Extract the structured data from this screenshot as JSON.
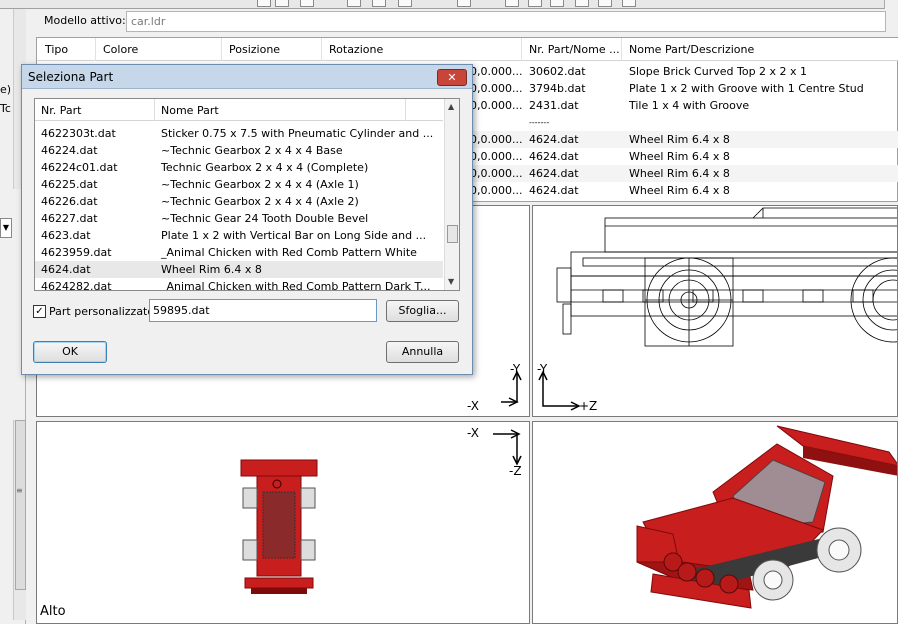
{
  "left_panel_labels": [
    "e)",
    "Tc"
  ],
  "model": {
    "label": "Modello attivo:",
    "value": "car.ldr"
  },
  "table": {
    "columns": [
      "Tipo",
      "Colore",
      "Posizione",
      "Rotazione",
      "Nr. Part/Nome ...",
      "Nome Part/Descrizione"
    ],
    "rows": [
      {
        "rotation": "0,0.000...",
        "part": "30602.dat",
        "desc": "Slope Brick Curved Top  2 x  2 x  1"
      },
      {
        "rotation": "0,0.000...",
        "part": "3794b.dat",
        "desc": "Plate  1 x  2 with Groove with 1 Centre Stud"
      },
      {
        "rotation": "0,0.000...",
        "part": "2431.dat",
        "desc": "Tile  1 x  4 with Groove"
      },
      {
        "rotation": "",
        "part": "-------",
        "desc": ""
      },
      {
        "rotation": "0,0.000...",
        "part": "4624.dat",
        "desc": "Wheel Rim  6.4 x  8"
      },
      {
        "rotation": "0,0.000...",
        "part": "4624.dat",
        "desc": "Wheel Rim  6.4 x  8"
      },
      {
        "rotation": "0,0.000...",
        "part": "4624.dat",
        "desc": "Wheel Rim  6.4 x  8"
      },
      {
        "rotation": "0,0.000...",
        "part": "4624.dat",
        "desc": "Wheel Rim  6.4 x  8"
      }
    ]
  },
  "viewports": {
    "front_axes": {
      "y": "-Y",
      "x": "-X"
    },
    "side_axes": {
      "y": "-Y",
      "z": "+Z"
    },
    "top_axes": {
      "x": "-X",
      "z": "-Z"
    },
    "top_label": "Alto"
  },
  "dialog": {
    "title": "Seleziona Part",
    "close_glyph": "✕",
    "list_columns": [
      "Nr. Part",
      "Nome Part"
    ],
    "list_rows": [
      {
        "id": "4622303t.dat",
        "name": "Sticker  0.75 x  7.5 with Pneumatic Cylinder and ..."
      },
      {
        "id": "46224.dat",
        "name": "~Technic Gearbox  2 x  4 x  4 Base"
      },
      {
        "id": "46224c01.dat",
        "name": "Technic Gearbox  2 x  4 x  4 (Complete)"
      },
      {
        "id": "46225.dat",
        "name": "~Technic Gearbox  2 x  4 x  4 (Axle 1)"
      },
      {
        "id": "46226.dat",
        "name": "~Technic Gearbox  2 x  4 x  4 (Axle 2)"
      },
      {
        "id": "46227.dat",
        "name": "~Technic Gear 24 Tooth Double Bevel"
      },
      {
        "id": "4623.dat",
        "name": "Plate  1 x  2 with Vertical Bar on Long Side and ..."
      },
      {
        "id": "4623959.dat",
        "name": "_Animal Chicken with Red Comb Pattern White"
      },
      {
        "id": "4624.dat",
        "name": "Wheel Rim  6.4 x  8"
      },
      {
        "id": "4624282.dat",
        "name": "_Animal Chicken with Red Comb Pattern Dark T..."
      }
    ],
    "selected_index": 8,
    "custom_checked": "✓",
    "custom_label": "Part personalizzato:",
    "custom_value": "59895.dat",
    "browse_label": "Sfoglia...",
    "ok_label": "OK",
    "cancel_label": "Annulla"
  },
  "colors": {
    "brick_red": "#c81e1e",
    "dark_red": "#7e0a0a",
    "window_bg": "#f0f0f0",
    "titlebar": "#c6d7ea",
    "close_red": "#c8453a"
  }
}
